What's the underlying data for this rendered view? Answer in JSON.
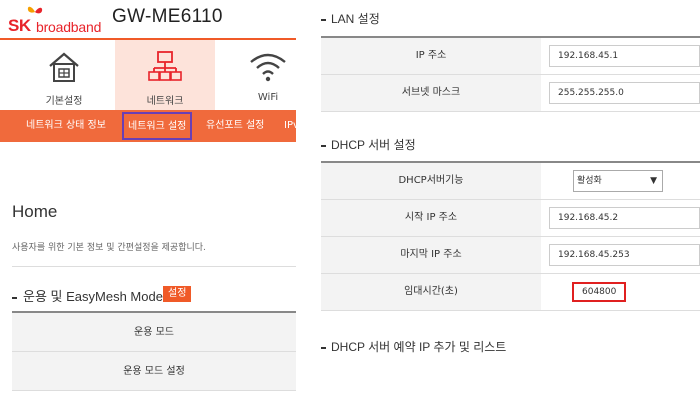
{
  "header": {
    "logo_sk": "SK",
    "logo_broadband": "broadband",
    "model": "GW-ME6110"
  },
  "nav_icons": [
    {
      "label": "기본설정",
      "icon": "home-icon"
    },
    {
      "label": "네트워크",
      "icon": "network-icon",
      "active": true
    },
    {
      "label": "WiFi",
      "icon": "wifi-icon"
    }
  ],
  "subnav": {
    "items": [
      "네트워크 상태 정보",
      "네트워크 설정",
      "유선포트 설정",
      "IPv"
    ]
  },
  "home": {
    "title": "Home",
    "description": "사용자를 위한 기본 정보 및 간편설정을 제공합니다."
  },
  "mode_section": {
    "title": "운용 및 EasyMesh Mode",
    "badge": "설정",
    "rows": [
      "운용 모드",
      "운용 모드 설정"
    ]
  },
  "lan": {
    "title": "LAN 설정",
    "rows": [
      {
        "label": "IP 주소",
        "value": "192.168.45.1"
      },
      {
        "label": "서브넷 마스크",
        "value": "255.255.255.0"
      }
    ]
  },
  "dhcp": {
    "title": "DHCP 서버 설정",
    "server_label": "DHCP서버기능",
    "server_value": "활성화",
    "rows": [
      {
        "label": "시작 IP 주소",
        "value": "192.168.45.2"
      },
      {
        "label": "마지막 IP 주소",
        "value": "192.168.45.253"
      },
      {
        "label": "임대시간(초)",
        "value": "604800"
      }
    ]
  },
  "dhcp_reserve": {
    "title": "DHCP 서버 예약 IP 추가 및 리스트"
  },
  "colors": {
    "brand": "#e8242b",
    "accent": "#f05a28",
    "highlight_purple": "#6a3fb5",
    "highlight_red": "#e02020"
  }
}
